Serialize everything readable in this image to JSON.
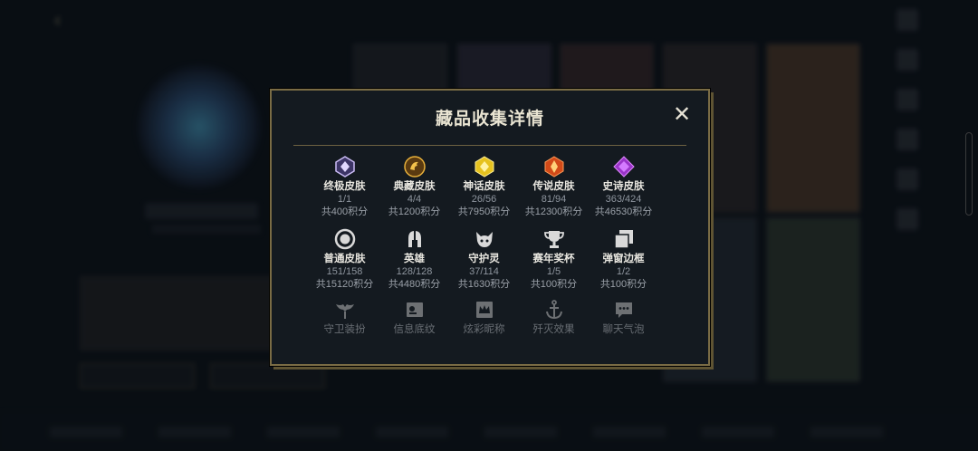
{
  "modal": {
    "title": "藏品收集详情"
  },
  "categories": [
    {
      "label": "终极皮肤",
      "count": "1/1",
      "points": "共400积分",
      "icon": "ultimate-gem-icon",
      "color": "#b9a6f0"
    },
    {
      "label": "典藏皮肤",
      "count": "4/4",
      "points": "共1200积分",
      "icon": "dragon-emblem-icon",
      "color": "#e0a12e"
    },
    {
      "label": "神话皮肤",
      "count": "26/56",
      "points": "共7950积分",
      "icon": "mythic-gem-icon",
      "color": "#e6c21f"
    },
    {
      "label": "传说皮肤",
      "count": "81/94",
      "points": "共12300积分",
      "icon": "legendary-gem-icon",
      "color": "#e2561f"
    },
    {
      "label": "史诗皮肤",
      "count": "363/424",
      "points": "共46530积分",
      "icon": "epic-gem-icon",
      "color": "#b04ad8"
    },
    {
      "label": "普通皮肤",
      "count": "151/158",
      "points": "共15120积分",
      "icon": "circle-icon",
      "color": "#d9d9d9"
    },
    {
      "label": "英雄",
      "count": "128/128",
      "points": "共4480积分",
      "icon": "helmet-icon",
      "color": "#d9d9d9"
    },
    {
      "label": "守护灵",
      "count": "37/114",
      "points": "共1630积分",
      "icon": "guardian-pet-icon",
      "color": "#d9d9d9"
    },
    {
      "label": "赛年奖杯",
      "count": "1/5",
      "points": "共100积分",
      "icon": "trophy-icon",
      "color": "#d9d9d9"
    },
    {
      "label": "弹窗边框",
      "count": "1/2",
      "points": "共100积分",
      "icon": "frame-icon",
      "color": "#d9d9d9"
    },
    {
      "label": "守卫装扮",
      "icon": "ward-icon"
    },
    {
      "label": "信息底纹",
      "icon": "card-pattern-icon"
    },
    {
      "label": "炫彩昵称",
      "icon": "crown-name-icon"
    },
    {
      "label": "歼灭效果",
      "icon": "anchor-icon"
    },
    {
      "label": "聊天气泡",
      "icon": "chat-bubble-icon"
    }
  ]
}
